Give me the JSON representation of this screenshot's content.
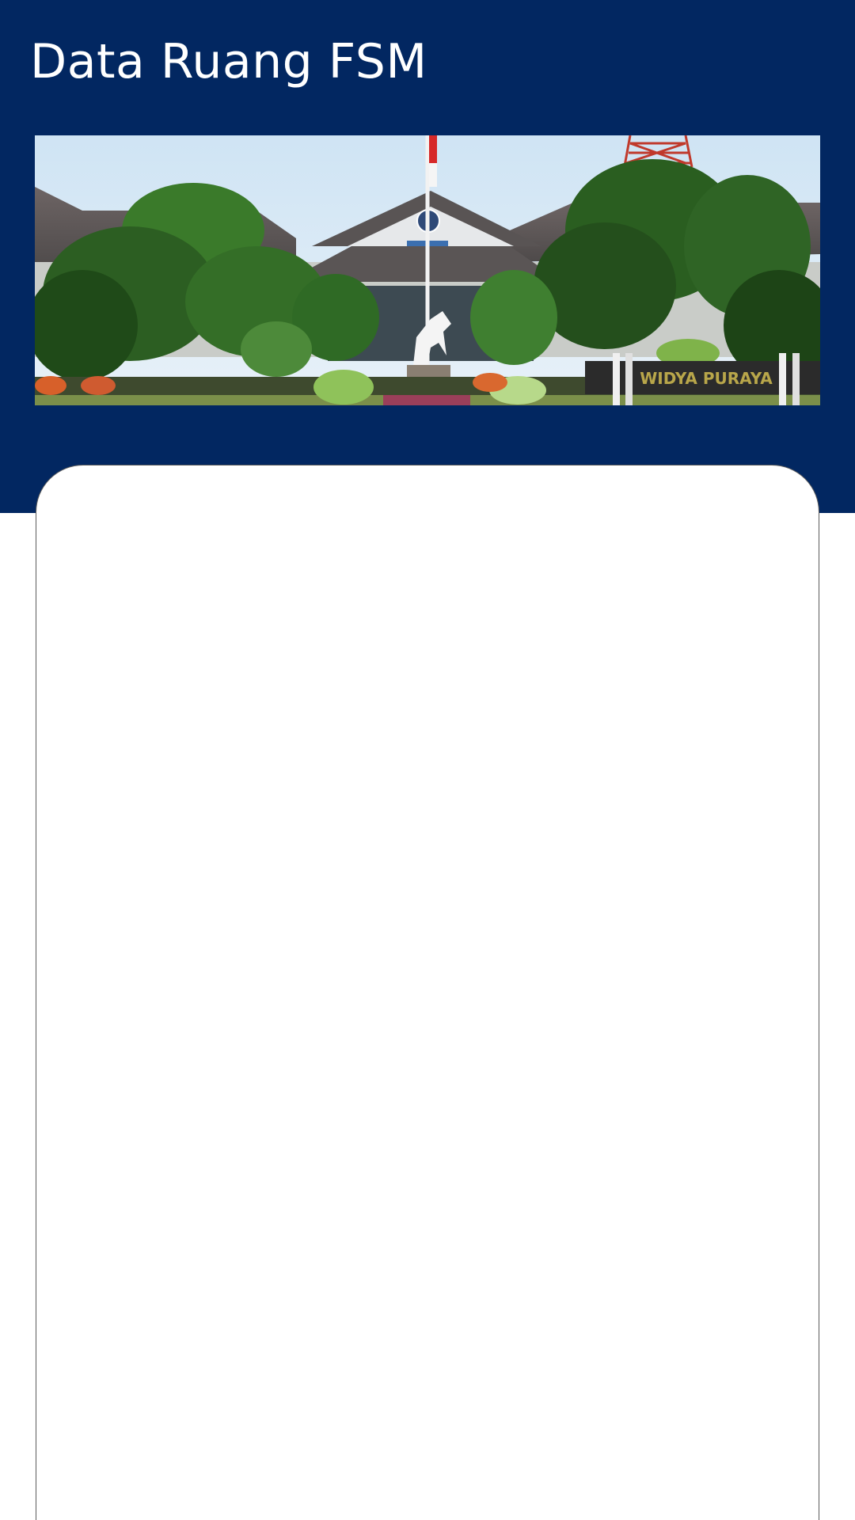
{
  "header": {
    "title": "Data Ruang FSM"
  },
  "banner": {
    "sign_text": "WIDYA PURAYA"
  },
  "colors": {
    "header_background": "#022761",
    "page_background": "#ffffff",
    "card_border": "#5c5c5c",
    "title_text": "#ffffff"
  }
}
